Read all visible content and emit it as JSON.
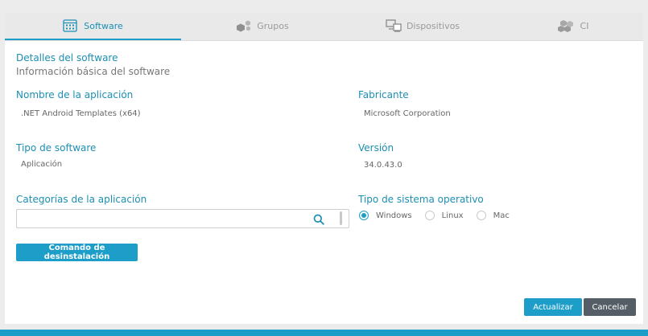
{
  "tabs": [
    {
      "label": "Software",
      "icon": "software-grid-icon",
      "active": true
    },
    {
      "label": "Grupos",
      "icon": "groups-cubes-icon",
      "active": false
    },
    {
      "label": "Dispositivos",
      "icon": "devices-icon",
      "active": false
    },
    {
      "label": "CI",
      "icon": "ci-boxes-icon",
      "active": false
    }
  ],
  "details": {
    "title": "Detalles del software",
    "subtitle": "Información básica del software"
  },
  "fields": {
    "app_name_label": "Nombre de la aplicación",
    "app_name_value": ".NET Android Templates (x64)",
    "manufacturer_label": "Fabricante",
    "manufacturer_value": "Microsoft Corporation",
    "software_type_label": "Tipo de software",
    "software_type_value": "Aplicación",
    "version_label": "Versión",
    "version_value": "34.0.43.0",
    "categories_label": "Categorías de la aplicación",
    "categories_value": "",
    "os_type_label": "Tipo de sistema operativo"
  },
  "os_options": [
    {
      "label": "Windows",
      "checked": true
    },
    {
      "label": "Linux",
      "checked": false
    },
    {
      "label": "Mac",
      "checked": false
    }
  ],
  "buttons": {
    "uninstall": "Comando de desinstalación",
    "update": "Actualizar",
    "cancel": "Cancelar"
  },
  "colors": {
    "accent": "#1c9ec9",
    "label_blue": "#1c8fb3",
    "cancel_bg": "#555e66"
  }
}
